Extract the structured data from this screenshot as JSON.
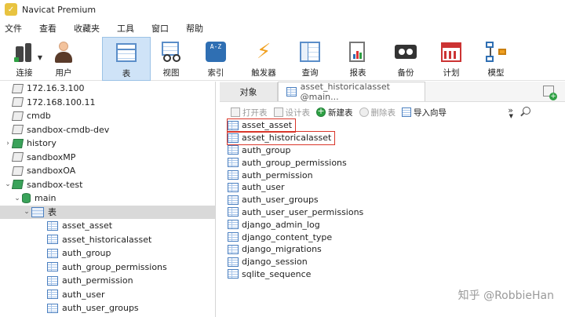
{
  "window": {
    "title": "Navicat Premium"
  },
  "menu": [
    "文件",
    "查看",
    "收藏夹",
    "工具",
    "窗口",
    "帮助"
  ],
  "toolbar": [
    {
      "label": "连接",
      "icon": "connection-icon",
      "dropdown": true
    },
    {
      "label": "用户",
      "icon": "user-icon"
    },
    {
      "label": "表",
      "icon": "table-icon",
      "active": true
    },
    {
      "label": "视图",
      "icon": "view-icon"
    },
    {
      "label": "索引",
      "icon": "index-icon",
      "icon_text": "A-Z"
    },
    {
      "label": "触发器",
      "icon": "trigger-icon"
    },
    {
      "label": "查询",
      "icon": "query-icon"
    },
    {
      "label": "报表",
      "icon": "report-icon"
    },
    {
      "label": "备份",
      "icon": "backup-icon"
    },
    {
      "label": "计划",
      "icon": "schedule-icon"
    },
    {
      "label": "模型",
      "icon": "model-icon"
    }
  ],
  "tree": [
    {
      "label": "172.16.3.100",
      "type": "connection",
      "level": 0
    },
    {
      "label": "172.168.100.11",
      "type": "connection",
      "level": 0
    },
    {
      "label": "cmdb",
      "type": "connection",
      "level": 0
    },
    {
      "label": "sandbox-cmdb-dev",
      "type": "connection",
      "level": 0
    },
    {
      "label": "history",
      "type": "connection-open",
      "level": 0,
      "expander": "collapsed"
    },
    {
      "label": "sandboxMP",
      "type": "connection",
      "level": 0
    },
    {
      "label": "sandboxOA",
      "type": "connection",
      "level": 0
    },
    {
      "label": "sandbox-test",
      "type": "connection-open",
      "level": 0,
      "expander": "expanded"
    },
    {
      "label": "main",
      "type": "database",
      "level": 1,
      "expander": "expanded"
    },
    {
      "label": "表",
      "type": "tables-folder",
      "level": 2,
      "expander": "expanded",
      "selected": true
    },
    {
      "label": "asset_asset",
      "type": "table",
      "level": 3
    },
    {
      "label": "asset_historicalasset",
      "type": "table",
      "level": 3
    },
    {
      "label": "auth_group",
      "type": "table",
      "level": 3
    },
    {
      "label": "auth_group_permissions",
      "type": "table",
      "level": 3
    },
    {
      "label": "auth_permission",
      "type": "table",
      "level": 3
    },
    {
      "label": "auth_user",
      "type": "table",
      "level": 3
    },
    {
      "label": "auth_user_groups",
      "type": "table",
      "level": 3
    }
  ],
  "tabs": {
    "objects": "对象",
    "current": "asset_historicalasset @main..."
  },
  "object_toolbar": [
    {
      "label": "打开表",
      "enabled": false
    },
    {
      "label": "设计表",
      "enabled": false
    },
    {
      "label": "新建表",
      "enabled": true,
      "icon": "add-icon"
    },
    {
      "label": "删除表",
      "enabled": false
    },
    {
      "label": "导入向导",
      "enabled": true,
      "icon": "import-icon"
    }
  ],
  "object_toolbar_more": "»",
  "objects": [
    {
      "name": "asset_asset",
      "highlighted": true
    },
    {
      "name": "asset_historicalasset",
      "highlighted": true
    },
    {
      "name": "auth_group"
    },
    {
      "name": "auth_group_permissions"
    },
    {
      "name": "auth_permission"
    },
    {
      "name": "auth_user"
    },
    {
      "name": "auth_user_groups"
    },
    {
      "name": "auth_user_user_permissions"
    },
    {
      "name": "django_admin_log"
    },
    {
      "name": "django_content_type"
    },
    {
      "name": "django_migrations"
    },
    {
      "name": "django_session"
    },
    {
      "name": "sqlite_sequence"
    }
  ],
  "watermark": "知乎 @RobbieHan",
  "colors": {
    "accent": "#cfe3f7",
    "highlight_border": "#d9362a",
    "selected_row": "#d9d9d9"
  }
}
